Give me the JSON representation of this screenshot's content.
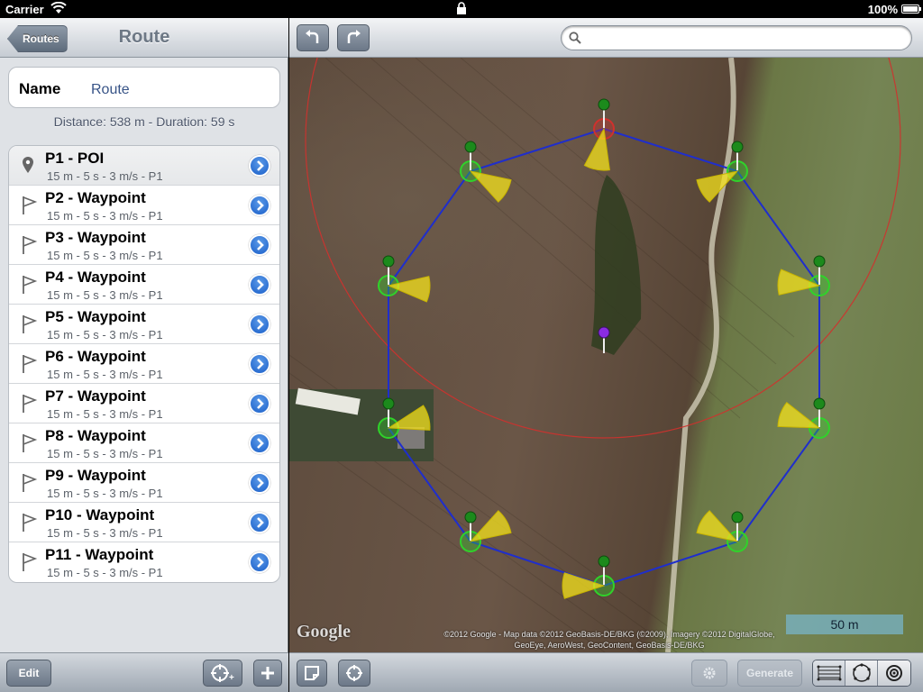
{
  "status": {
    "carrier": "Carrier",
    "battery": "100%"
  },
  "left_nav": {
    "back_label": "Routes",
    "title": "Route"
  },
  "name_field": {
    "label": "Name",
    "value": "Route"
  },
  "summary": "Distance: 538 m - Duration: 59 s",
  "points": [
    {
      "title": "P1 - POI",
      "subtitle": "15 m - 5 s - 3 m/s - P1",
      "icon": "poi-pin-icon"
    },
    {
      "title": "P2 - Waypoint",
      "subtitle": "15 m - 5 s - 3 m/s - P1",
      "icon": "flag-icon"
    },
    {
      "title": "P3 - Waypoint",
      "subtitle": "15 m - 5 s - 3 m/s - P1",
      "icon": "flag-icon"
    },
    {
      "title": "P4 - Waypoint",
      "subtitle": "15 m - 5 s - 3 m/s - P1",
      "icon": "flag-icon"
    },
    {
      "title": "P5 - Waypoint",
      "subtitle": "15 m - 5 s - 3 m/s - P1",
      "icon": "flag-icon"
    },
    {
      "title": "P6 - Waypoint",
      "subtitle": "15 m - 5 s - 3 m/s - P1",
      "icon": "flag-icon"
    },
    {
      "title": "P7 - Waypoint",
      "subtitle": "15 m - 5 s - 3 m/s - P1",
      "icon": "flag-icon"
    },
    {
      "title": "P8 - Waypoint",
      "subtitle": "15 m - 5 s - 3 m/s - P1",
      "icon": "flag-icon"
    },
    {
      "title": "P9 - Waypoint",
      "subtitle": "15 m - 5 s - 3 m/s - P1",
      "icon": "flag-icon"
    },
    {
      "title": "P10 - Waypoint",
      "subtitle": "15 m - 5 s - 3 m/s - P1",
      "icon": "flag-icon"
    },
    {
      "title": "P11 - Waypoint",
      "subtitle": "15 m - 5 s - 3 m/s - P1",
      "icon": "flag-icon"
    }
  ],
  "left_toolbar": {
    "edit_label": "Edit"
  },
  "search": {
    "placeholder": "",
    "value": ""
  },
  "map": {
    "attribution_line1": "©2012 Google - Map data ©2012 GeoBasis-DE/BKG (©2009), Imagery ©2012 DigitalGlobe,",
    "attribution_line2": "GeoEye, AeroWest, GeoContent, GeoBasis-DE/BKG",
    "logo_text": "Google",
    "scale_label": "50 m",
    "colors": {
      "route_line": "#1f2ecc",
      "waypoint": "#2fd32a",
      "heading_cone": "#f4e21c",
      "poi_marker": "#8a2be2",
      "radius_circle": "#d0312d"
    }
  },
  "right_toolbar": {
    "generate_label": "Generate"
  },
  "icons": {
    "undo": "undo-icon",
    "redo": "redo-icon",
    "search": "search-icon",
    "note": "note-icon",
    "locate": "crosshair-icon",
    "settings": "gear-icon",
    "grid_mode": "grid-pattern-icon",
    "circle_mode": "circle-pattern-icon",
    "orbit_mode": "orbit-pattern-icon"
  }
}
